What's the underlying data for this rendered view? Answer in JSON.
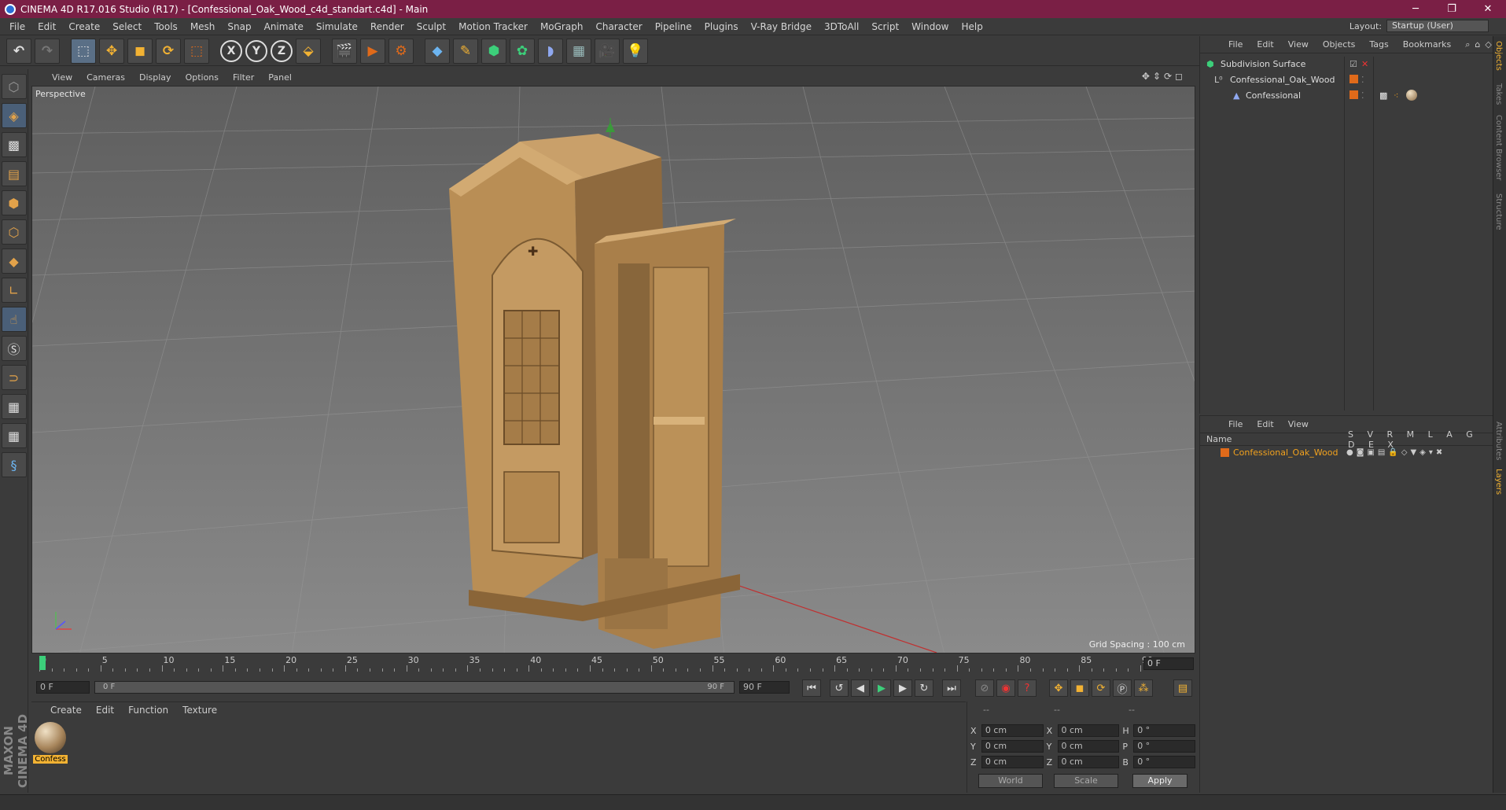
{
  "window": {
    "title": "CINEMA 4D R17.016 Studio (R17) - [Confessional_Oak_Wood_c4d_standart.c4d] - Main"
  },
  "menus": [
    "File",
    "Edit",
    "Create",
    "Select",
    "Tools",
    "Mesh",
    "Snap",
    "Animate",
    "Simulate",
    "Render",
    "Sculpt",
    "Motion Tracker",
    "MoGraph",
    "Character",
    "Pipeline",
    "Plugins",
    "V-Ray Bridge",
    "3DToAll",
    "Script",
    "Window",
    "Help"
  ],
  "layout": {
    "label": "Layout:",
    "value": "Startup (User)"
  },
  "viewport": {
    "menu": [
      "View",
      "Cameras",
      "Display",
      "Options",
      "Filter",
      "Panel"
    ],
    "label": "Perspective",
    "grid_spacing": "Grid Spacing : 100 cm"
  },
  "timeline": {
    "ticks": [
      "0",
      "5",
      "10",
      "15",
      "20",
      "25",
      "30",
      "35",
      "40",
      "45",
      "50",
      "55",
      "60",
      "65",
      "70",
      "75",
      "80",
      "85",
      "90"
    ],
    "current_frame": "0 F"
  },
  "transport": {
    "start_field": "0 F",
    "slider_start": "0 F",
    "slider_end": "90 F",
    "end_field": "90 F"
  },
  "material_manager": {
    "menu": [
      "Create",
      "Edit",
      "Function",
      "Texture"
    ],
    "materials": [
      {
        "label": "Confess"
      }
    ]
  },
  "coords": {
    "headers": [
      "--",
      "--",
      "--"
    ],
    "rows": [
      {
        "a1": "X",
        "v1": "0 cm",
        "a2": "X",
        "v2": "0 cm",
        "a3": "H",
        "v3": "0 °"
      },
      {
        "a1": "Y",
        "v1": "0 cm",
        "a2": "Y",
        "v2": "0 cm",
        "a3": "P",
        "v3": "0 °"
      },
      {
        "a1": "Z",
        "v1": "0 cm",
        "a2": "Z",
        "v2": "0 cm",
        "a3": "B",
        "v3": "0 °"
      }
    ],
    "world": "World",
    "scale": "Scale",
    "apply": "Apply"
  },
  "object_manager": {
    "menu": [
      "File",
      "Edit",
      "View",
      "Objects",
      "Tags",
      "Bookmarks"
    ],
    "objects": [
      {
        "name": "Subdivision Surface"
      },
      {
        "name": "Confessional_Oak_Wood"
      },
      {
        "name": "Confessional"
      }
    ]
  },
  "layer_manager": {
    "menu": [
      "File",
      "Edit",
      "View"
    ],
    "name_header": "Name",
    "columns": "S V R M L A G D E X",
    "layers": [
      {
        "name": "Confessional_Oak_Wood"
      }
    ]
  },
  "side_tabs": [
    "Objects",
    "Takes",
    "Content Browser",
    "Structure",
    "Attributes",
    "Layers"
  ],
  "colors": {
    "title_bar": "#7a1f45",
    "accent": "#f2a21e",
    "layer_color": "#e06a1a"
  },
  "brand": "MAXON CINEMA 4D"
}
